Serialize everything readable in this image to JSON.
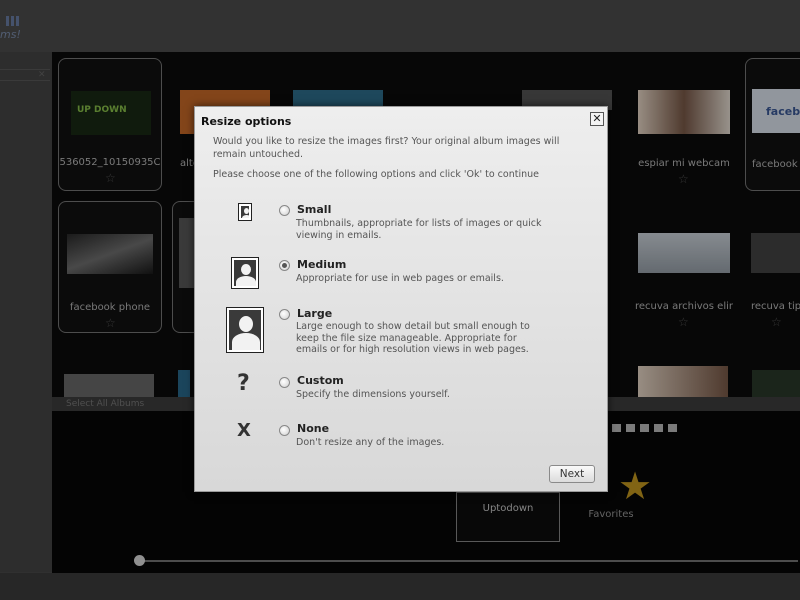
{
  "app": {
    "logo_text": "ms!",
    "gallery_tiles": [
      {
        "label": "536052_10150935C",
        "thumb_text": "UP DOWN"
      },
      {
        "label": "alto"
      },
      {
        "label": ""
      },
      {
        "label": ""
      },
      {
        "label": ""
      },
      {
        "label": "espiar mi webcam"
      },
      {
        "label": "facebook",
        "thumb_text": "facebo"
      },
      {
        "label": "facebook phone"
      },
      {
        "label": ""
      },
      {
        "label": "recuva archivos elir"
      },
      {
        "label": "recuva tip"
      }
    ],
    "lower_bar_label": "Select All Albums",
    "albums": [
      {
        "label": "Uptodown"
      },
      {
        "label": "Favorites"
      }
    ]
  },
  "dialog": {
    "title": "Resize options",
    "close_glyph": "✕",
    "intro": "Would you like to resize the images first? Your original album images will remain untouched.",
    "instruction": "Please choose one of the following options and click 'Ok' to continue",
    "options": [
      {
        "name": "Small",
        "description": "Thumbnails, appropriate for lists of images or quick viewing in emails.",
        "selected": false
      },
      {
        "name": "Medium",
        "description": "Appropriate for use in web pages or emails.",
        "selected": true
      },
      {
        "name": "Large",
        "description": "Large enough to show detail but small enough to keep the file size manageable. Appropriate for emails or for high resolution views in web pages.",
        "selected": false
      },
      {
        "name": "Custom",
        "description": "Specify the dimensions yourself.",
        "selected": false,
        "glyph": "?"
      },
      {
        "name": "None",
        "description": "Don't resize any of the images.",
        "selected": false,
        "glyph": "X"
      }
    ],
    "next_label": "Next"
  },
  "colors": {
    "dialog_bg": "#e4e4e4",
    "favorites_star": "#c69a20"
  }
}
